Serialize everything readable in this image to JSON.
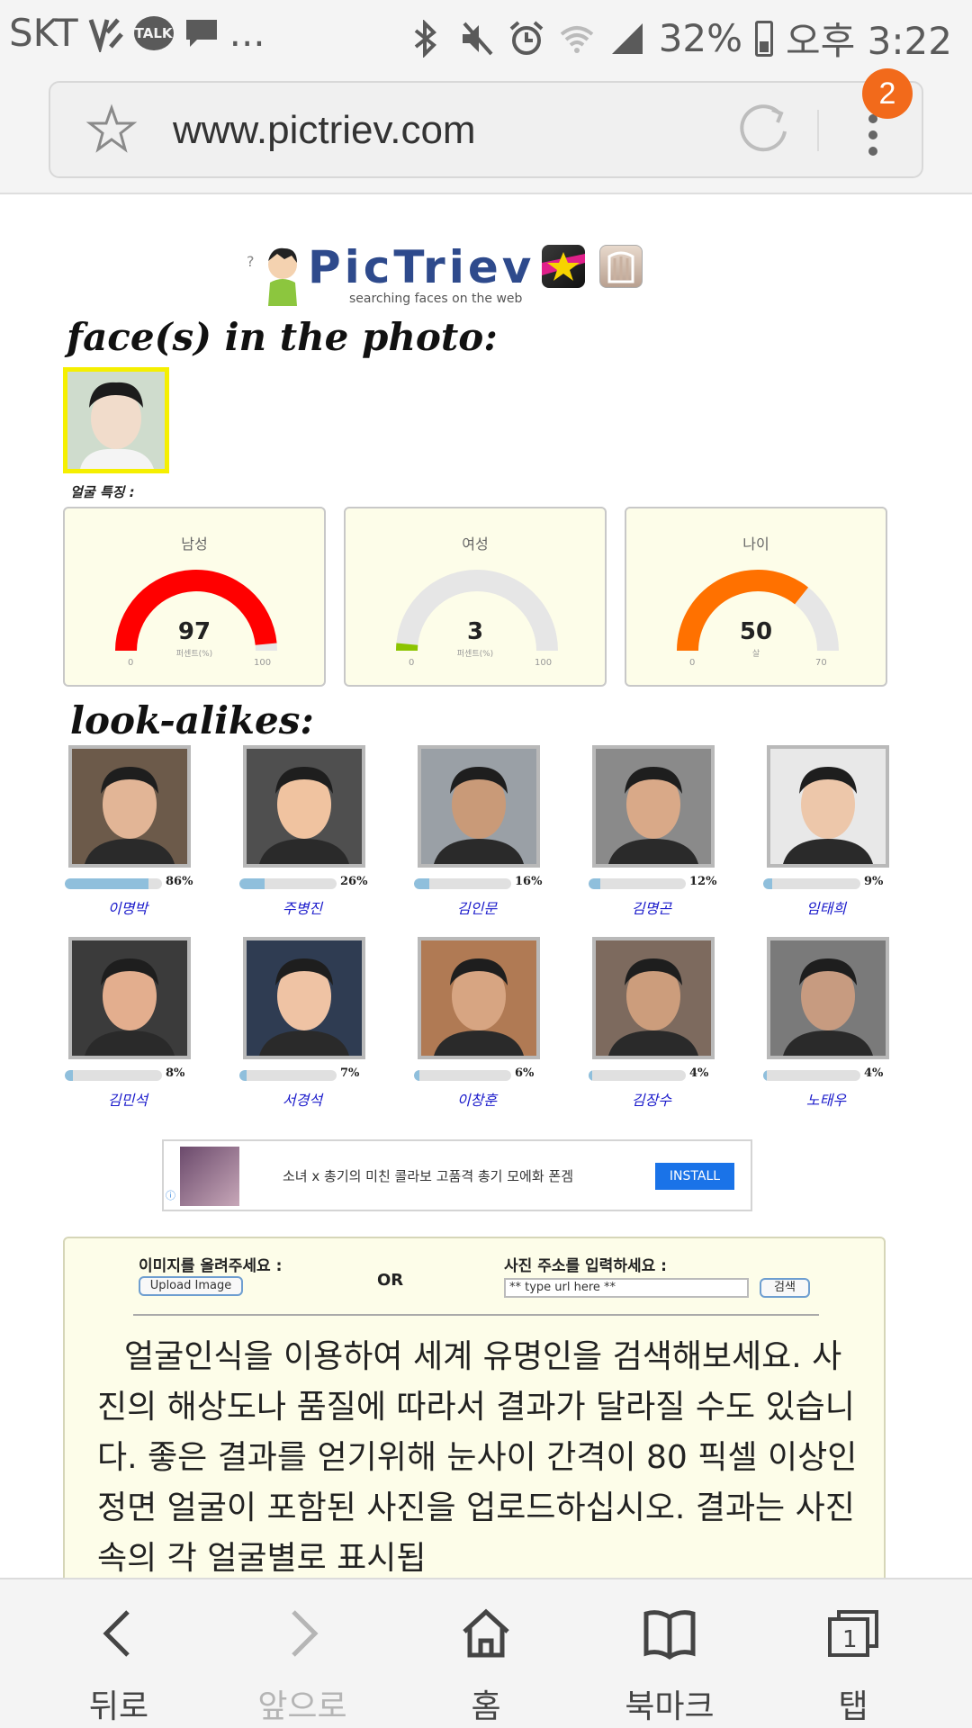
{
  "status_bar": {
    "carrier": "SKT",
    "talk": "TALK",
    "more": "...",
    "battery": "32%",
    "time": "오후 3:22"
  },
  "browser": {
    "url": "www.pictriev.com",
    "tab_badge": "2"
  },
  "page": {
    "logo": "PicTriev",
    "logo_tagline": "searching faces on the web",
    "faces_title": "face(s) in the photo:",
    "features_label": "얼굴 특징 :",
    "gauges": [
      {
        "title": "남성",
        "value": 97,
        "unit": "퍼센트(%)",
        "min": "0",
        "max": "100",
        "fraction": 0.97,
        "color": "#ff0000"
      },
      {
        "title": "여성",
        "value": 3,
        "unit": "퍼센트(%)",
        "min": "0",
        "max": "100",
        "fraction": 0.03,
        "color": "#8cc400"
      },
      {
        "title": "나이",
        "value": 50,
        "unit": "살",
        "min": "0",
        "max": "70",
        "fraction": 0.714,
        "color": "#ff7100"
      }
    ],
    "lookalikes_title": "look-alikes:",
    "lookalikes": [
      {
        "name": "이명박",
        "pct": "86%",
        "value": 86
      },
      {
        "name": "주병진",
        "pct": "26%",
        "value": 26
      },
      {
        "name": "김인문",
        "pct": "16%",
        "value": 16
      },
      {
        "name": "김명곤",
        "pct": "12%",
        "value": 12
      },
      {
        "name": "임태희",
        "pct": "9%",
        "value": 9
      },
      {
        "name": "김민석",
        "pct": "8%",
        "value": 8
      },
      {
        "name": "서경석",
        "pct": "7%",
        "value": 7
      },
      {
        "name": "이창훈",
        "pct": "6%",
        "value": 6
      },
      {
        "name": "김장수",
        "pct": "4%",
        "value": 4
      },
      {
        "name": "노태우",
        "pct": "4%",
        "value": 4
      }
    ],
    "ad": {
      "text": "소녀 x 총기의 미친 콜라보 고품격 총기 모에화 폰겜",
      "button": "INSTALL"
    },
    "search": {
      "upload_label": "이미지를 올려주세요 :",
      "upload_button": "Upload Image",
      "or": "OR",
      "url_label": "사진 주소를 입력하세요 :",
      "url_value": "** type url here **",
      "search_button": "검색",
      "description": "얼굴인식을 이용하여 세계 유명인을 검색해보세요. 사진의 해상도나 품질에 따라서 결과가 달라질 수도 있습니다. 좋은 결과를 얻기위해 눈사이 간격이 80 픽셀 이상인 정면 얼굴이 포함된 사진을 업로드하십시오. 결과는 사진속의 각 얼굴별로 표시됩"
    }
  },
  "bottom_nav": [
    {
      "label": "뒤로",
      "icon": "back-icon"
    },
    {
      "label": "앞으로",
      "icon": "forward-icon"
    },
    {
      "label": "홈",
      "icon": "home-icon"
    },
    {
      "label": "북마크",
      "icon": "bookmark-icon"
    },
    {
      "label": "탭",
      "icon": "tabs-icon",
      "count": "1"
    }
  ]
}
